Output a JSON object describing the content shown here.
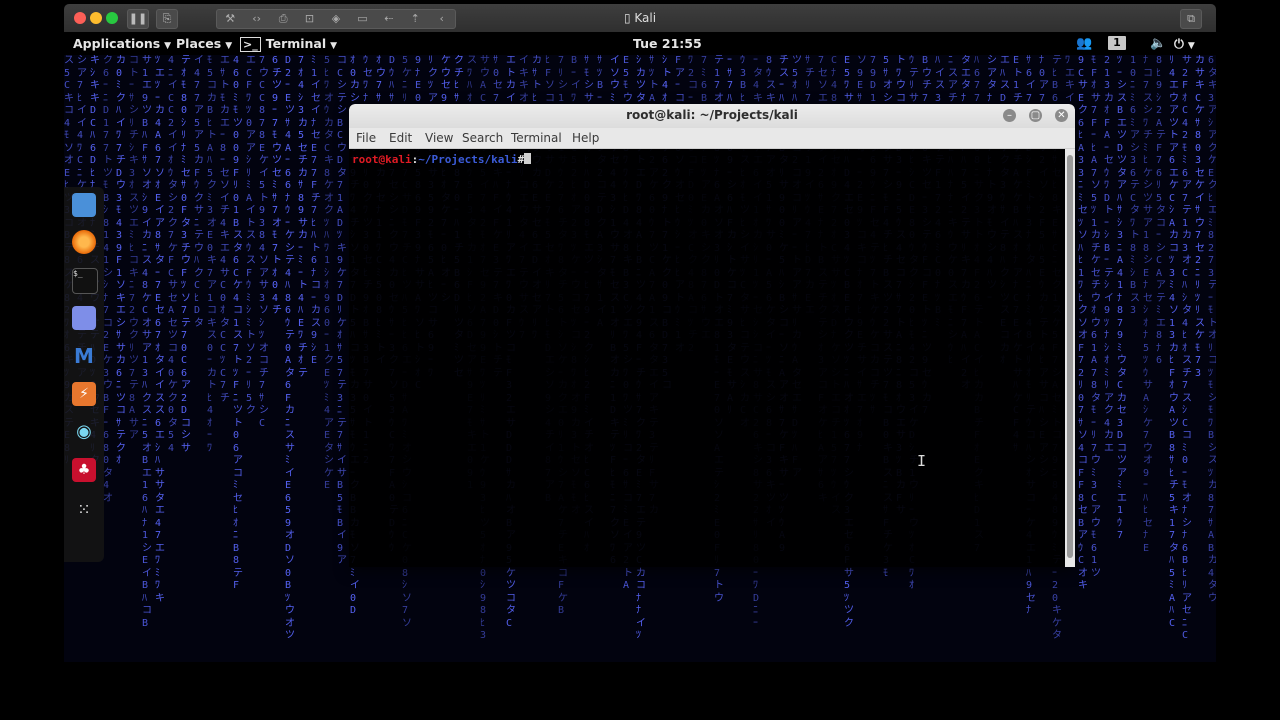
{
  "vm_window": {
    "title": "Kali",
    "toolbar_icons": [
      "pause-icon",
      "snapshot-icon",
      "wrench-icon",
      "code-icon",
      "print-icon",
      "lock-icon",
      "usb-icon",
      "camera-icon",
      "share-icon",
      "share2-icon",
      "back-icon"
    ]
  },
  "topbar": {
    "applications_label": "Applications",
    "places_label": "Places",
    "terminal_label": "Terminal",
    "clock": "Tue 21:55",
    "workspace_number": "1"
  },
  "dock": {
    "items": [
      "files-icon",
      "firefox-icon",
      "terminal-icon",
      "text-editor-icon",
      "metasploit-icon",
      "burpsuite-icon",
      "eye-icon",
      "cherrytree-icon",
      "show-apps-icon"
    ]
  },
  "terminal": {
    "title": "root@kali: ~/Projects/kali",
    "menu": [
      "File",
      "Edit",
      "View",
      "Search",
      "Terminal",
      "Help"
    ],
    "prompt_user": "root@kali",
    "prompt_colon": ":",
    "prompt_path": "~/Projects/kali",
    "prompt_symbol": "#"
  },
  "colors": {
    "matrix_blue": "#5a67ff",
    "prompt_red": "#e01b24",
    "prompt_blue": "#3b5bd8"
  }
}
